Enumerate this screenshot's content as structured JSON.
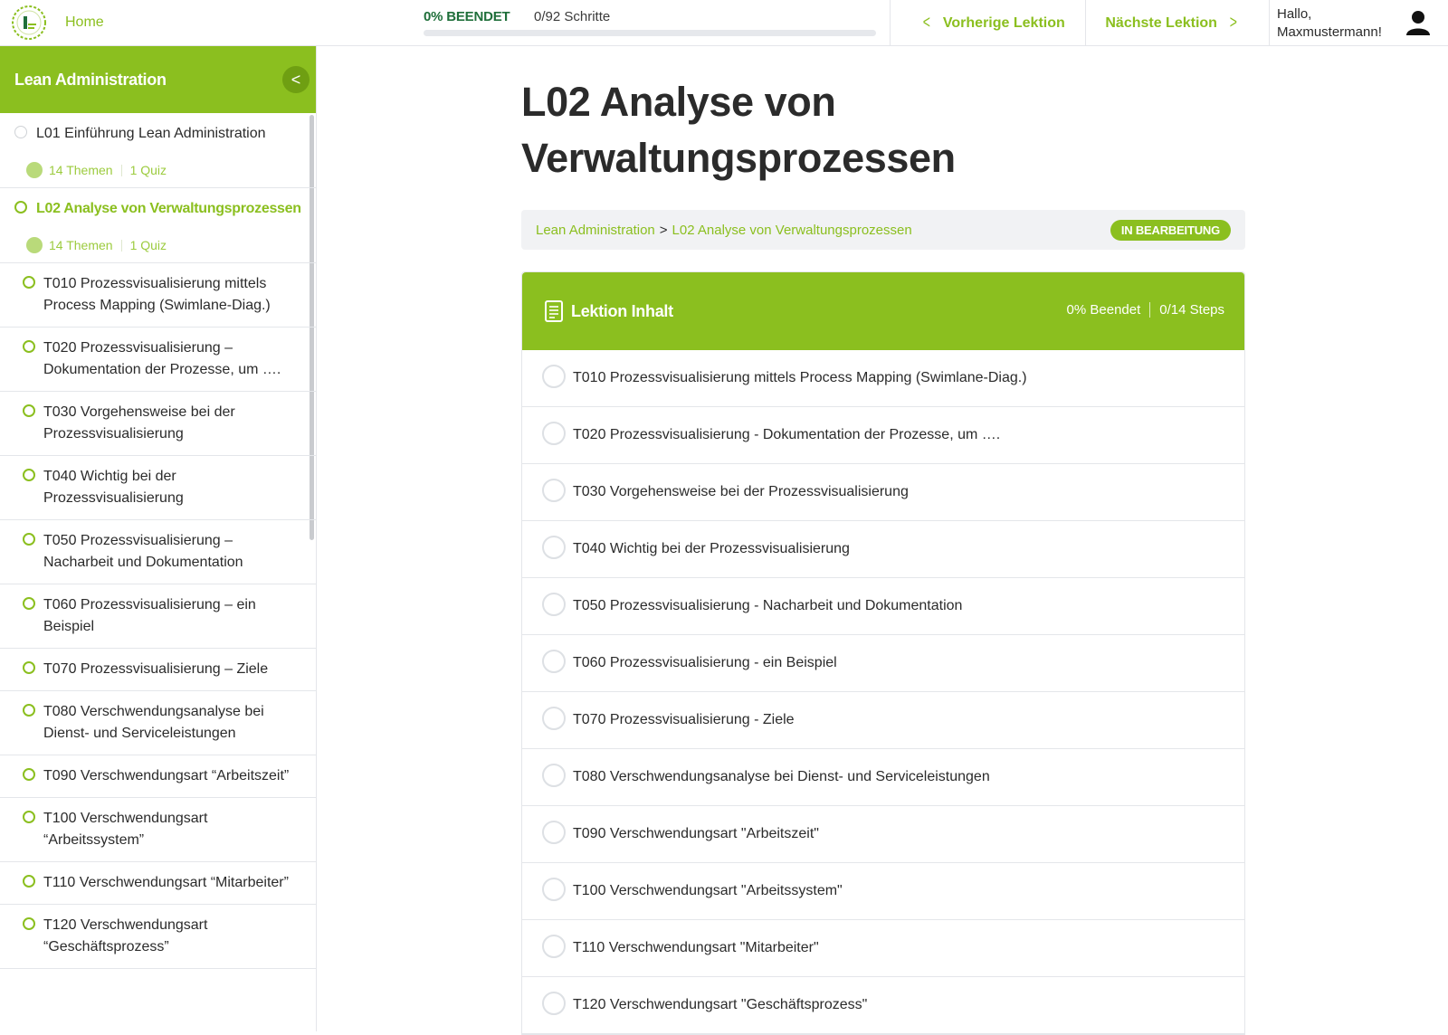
{
  "topbar": {
    "home_label": "Home",
    "progress_pct_label": "0% BEENDET",
    "progress_steps_label": "0/92 Schritte",
    "progress_fraction": 0,
    "prev_label": "Vorherige Lektion",
    "next_label": "Nächste Lektion",
    "greeting_line1": "Hallo,",
    "greeting_line2": "Maxmustermann!"
  },
  "sidebar": {
    "course_title": "Lean Administration",
    "lessons": [
      {
        "title": "L01 Einführung Lean Administration",
        "topics_label": "14 Themen",
        "quiz_label": "1 Quiz"
      },
      {
        "title": "L02 Analyse von Verwaltungsprozessen",
        "topics_label": "14 Themen",
        "quiz_label": "1 Quiz"
      }
    ],
    "topics": [
      "T010 Prozessvisualisierung mittels Process Mapping (Swimlane-Diag.)",
      "T020 Prozessvisualisierung – Dokumentation der Prozesse, um ….",
      "T030 Vorgehensweise bei der Prozessvisualisierung",
      "T040 Wichtig bei der Prozessvisualisierung",
      "T050 Prozessvisualisierung – Nacharbeit und Dokumentation",
      "T060 Prozessvisualisierung – ein Beispiel",
      "T070 Prozessvisualisierung – Ziele",
      "T080 Verschwendungsanalyse bei Dienst- und Serviceleistungen",
      "T090 Verschwendungsart “Arbeitszeit”",
      "T100 Verschwendungsart “Arbeitssystem”",
      "T110 Verschwendungsart “Mitarbeiter”",
      "T120 Verschwendungsart “Geschäftsprozess”"
    ]
  },
  "main": {
    "title_line1": "L02 Analyse von",
    "title_line2": "Verwaltungsprozessen",
    "breadcrumb": {
      "course": "Lean Administration",
      "separator": ">",
      "lesson": "L02 Analyse von Verwaltungsprozessen"
    },
    "status_badge": "IN BEARBEITUNG",
    "content": {
      "title": "Lektion Inhalt",
      "pct_label": "0% Beendet",
      "steps_label": "0/14 Steps",
      "items": [
        "T010 Prozessvisualisierung mittels Process Mapping (Swimlane-Diag.)",
        "T020 Prozessvisualisierung - Dokumentation der Prozesse, um ….",
        "T030 Vorgehensweise bei der Prozessvisualisierung",
        "T040 Wichtig bei der Prozessvisualisierung",
        "T050 Prozessvisualisierung - Nacharbeit und Dokumentation",
        "T060 Prozessvisualisierung - ein Beispiel",
        "T070 Prozessvisualisierung - Ziele",
        "T080 Verschwendungsanalyse bei Dienst- und Serviceleistungen",
        "T090 Verschwendungsart \"Arbeitszeit\"",
        "T100 Verschwendungsart \"Arbeitssystem\"",
        "T110 Verschwendungsart \"Mitarbeiter\"",
        "T120 Verschwendungsart \"Geschäftsprozess\""
      ]
    }
  },
  "colors": {
    "accent": "#8bbf1f",
    "accent_dark": "#1f6f3a",
    "border": "#e4e6ea",
    "text": "#2b2b2b"
  },
  "icons": {
    "logo": "logo-icon",
    "prev": "chevron-left-icon",
    "next": "chevron-right-icon",
    "avatar": "user-icon",
    "collapse": "chevron-left-icon",
    "content": "document-icon",
    "status": "circle-icon"
  }
}
